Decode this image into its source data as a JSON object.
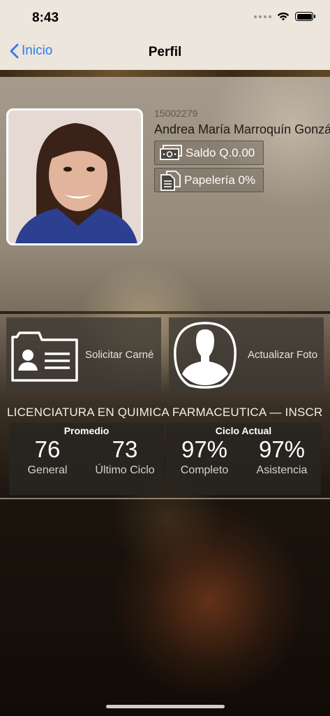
{
  "status_bar": {
    "time": "8:43"
  },
  "nav": {
    "back_label": "Inicio",
    "title": "Perfil"
  },
  "profile": {
    "student_id": "15002279",
    "name": "Andrea María Marroquín Gonzál",
    "saldo_label": "Saldo Q.0.00",
    "papeleria_label": "Papelería 0%"
  },
  "actions": {
    "carne_label": "Solicitar Carné",
    "foto_label": "Actualizar Foto"
  },
  "career": {
    "title": "LICENCIATURA EN QUIMICA FARMACEUTICA — INSCR",
    "promedio": {
      "header": "Promedio",
      "general_value": "76",
      "general_label": "General",
      "ultimo_value": "73",
      "ultimo_label": "Último Ciclo"
    },
    "ciclo": {
      "header": "Ciclo Actual",
      "completo_value": "97%",
      "completo_label": "Completo",
      "asistencia_value": "97%",
      "asistencia_label": "Asistencia"
    }
  },
  "icons": {
    "back": "chevron-left-icon",
    "wifi": "wifi-icon",
    "battery": "battery-icon",
    "money": "money-icon",
    "document": "document-icon",
    "id_card": "id-card-icon",
    "person": "person-icon"
  },
  "colors": {
    "accent": "#2a7bf6"
  }
}
